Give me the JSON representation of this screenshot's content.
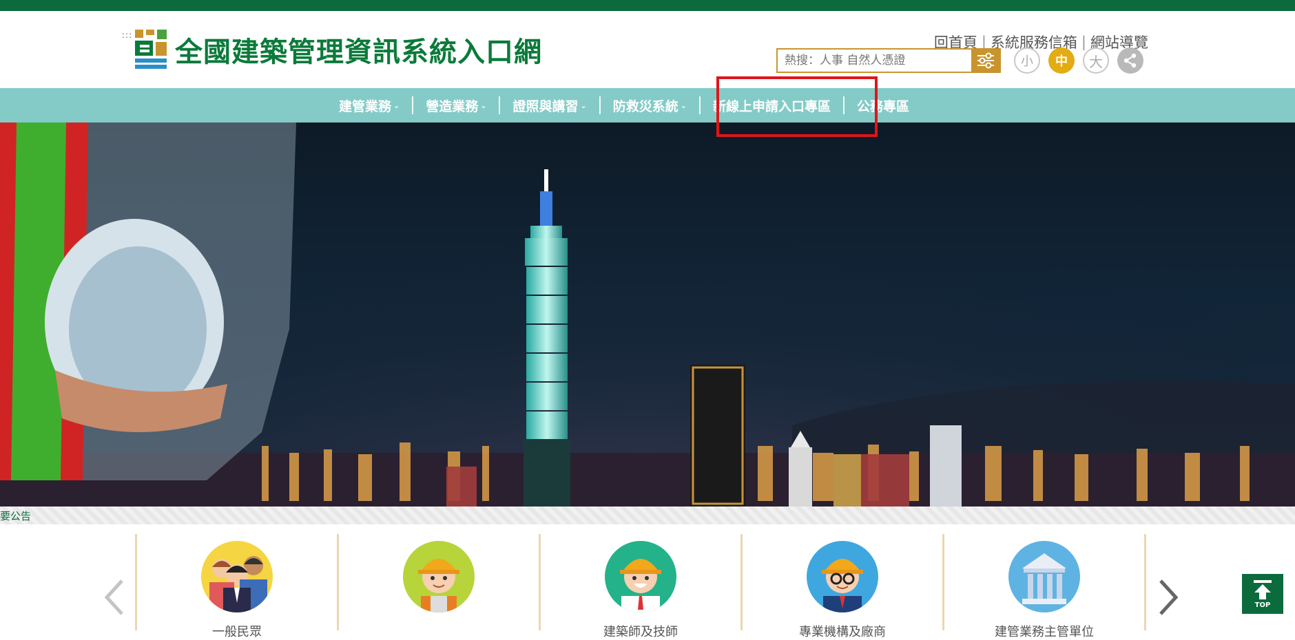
{
  "site": {
    "title": "全國建築管理資訊系統入口網"
  },
  "toplinks": {
    "home": "回首頁",
    "mailbox": "系統服務信箱",
    "sitemap": "網站導覽"
  },
  "search": {
    "placeholder": "熱搜：人事 自然人憑證",
    "value": ""
  },
  "font_size": {
    "small": "小",
    "medium": "中",
    "large": "大",
    "selected": "中"
  },
  "nav": {
    "items": [
      {
        "label": "建管業務",
        "has_dropdown": true
      },
      {
        "label": "營造業務",
        "has_dropdown": true
      },
      {
        "label": "證照與講習",
        "has_dropdown": true
      },
      {
        "label": "防救災系統",
        "has_dropdown": true
      },
      {
        "label": "新線上申請入口專區",
        "has_dropdown": false,
        "highlighted": true
      },
      {
        "label": "公務專區",
        "has_dropdown": false
      }
    ]
  },
  "ticker": {
    "text": "要公告"
  },
  "cards": [
    {
      "label": "一般民眾",
      "icon": "people-group-avatar"
    },
    {
      "label": "",
      "icon": "construction-worker-avatar"
    },
    {
      "label": "建築師及技師",
      "icon": "architect-avatar"
    },
    {
      "label": "專業機構及廠商",
      "icon": "professional-avatar"
    },
    {
      "label": "建管業務主管單位",
      "icon": "government-building-avatar"
    }
  ],
  "top_button": {
    "label": "TOP"
  },
  "colors": {
    "brand_green": "#0b6b3c",
    "nav_teal": "#84cbc7",
    "accent_gold": "#c9942c",
    "highlight_red": "#e0141b"
  }
}
